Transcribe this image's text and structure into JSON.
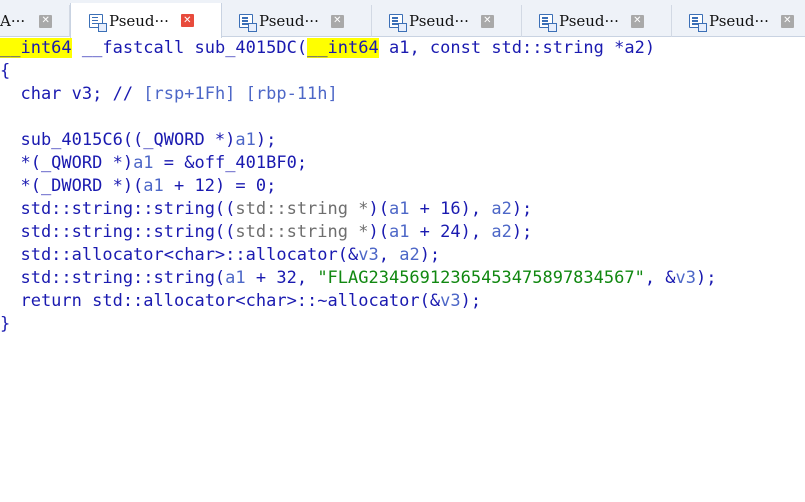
{
  "tabs": [
    {
      "label": "A···",
      "active": false
    },
    {
      "label": "Pseud···",
      "active": true
    },
    {
      "label": "Pseud···",
      "active": false
    },
    {
      "label": "Pseud···",
      "active": false
    },
    {
      "label": "Pseud···",
      "active": false
    },
    {
      "label": "Pseud···",
      "active": false
    }
  ],
  "code": {
    "sig": {
      "ret_type": "__int64",
      "callconv": " __fastcall ",
      "func_name": "sub_4015DC(",
      "param_type": "__int64",
      "param_name": " a1, const std::string *a2)"
    },
    "open_brace": "{",
    "decl": {
      "prefix": "  char v3; // ",
      "comment": "[rsp+1Fh] [rbp-11h]"
    },
    "l1": {
      "a": "  sub_4015C6((_QWORD *)",
      "v": "a1",
      "b": ");"
    },
    "l2": {
      "a": "  *(_QWORD *)",
      "v": "a1",
      "b": " = &off_401BF0;"
    },
    "l3": {
      "a": "  *(_DWORD *)(",
      "v": "a1",
      "b": " + 12) = 0;"
    },
    "l4": {
      "a": "  std::string::string((",
      "g": "std::string *",
      "b": ")(",
      "v": "a1",
      "c": " + 16), ",
      "v2": "a2",
      "d": ");"
    },
    "l5": {
      "a": "  std::string::string((",
      "g": "std::string *",
      "b": ")(",
      "v": "a1",
      "c": " + 24), ",
      "v2": "a2",
      "d": ");"
    },
    "l6": {
      "a": "  std::allocator<char>::allocator(&",
      "v": "v3",
      "b": ", ",
      "v2": "a2",
      "c": ");"
    },
    "l7": {
      "a": "  std::string::string(",
      "v": "a1",
      "b": " + 32, ",
      "s": "\"FLAG23456912365453475897834567\"",
      "c": ", &",
      "v2": "v3",
      "d": ");"
    },
    "l8": {
      "a": "  return std::allocator<char>::~allocator(&",
      "v": "v3",
      "b": ");"
    },
    "close_brace": "}"
  },
  "colors": {
    "highlight": "#ffff00",
    "keyword_blue": "#1a1ab0",
    "variable_blue": "#4d67c7",
    "string_green": "#118811",
    "comment_gray": "#6e6e6e",
    "active_close": "#e84b3c"
  },
  "icons": {
    "tab_icon": "pseudocode-document-icon",
    "close_icon": "close-x-icon"
  }
}
